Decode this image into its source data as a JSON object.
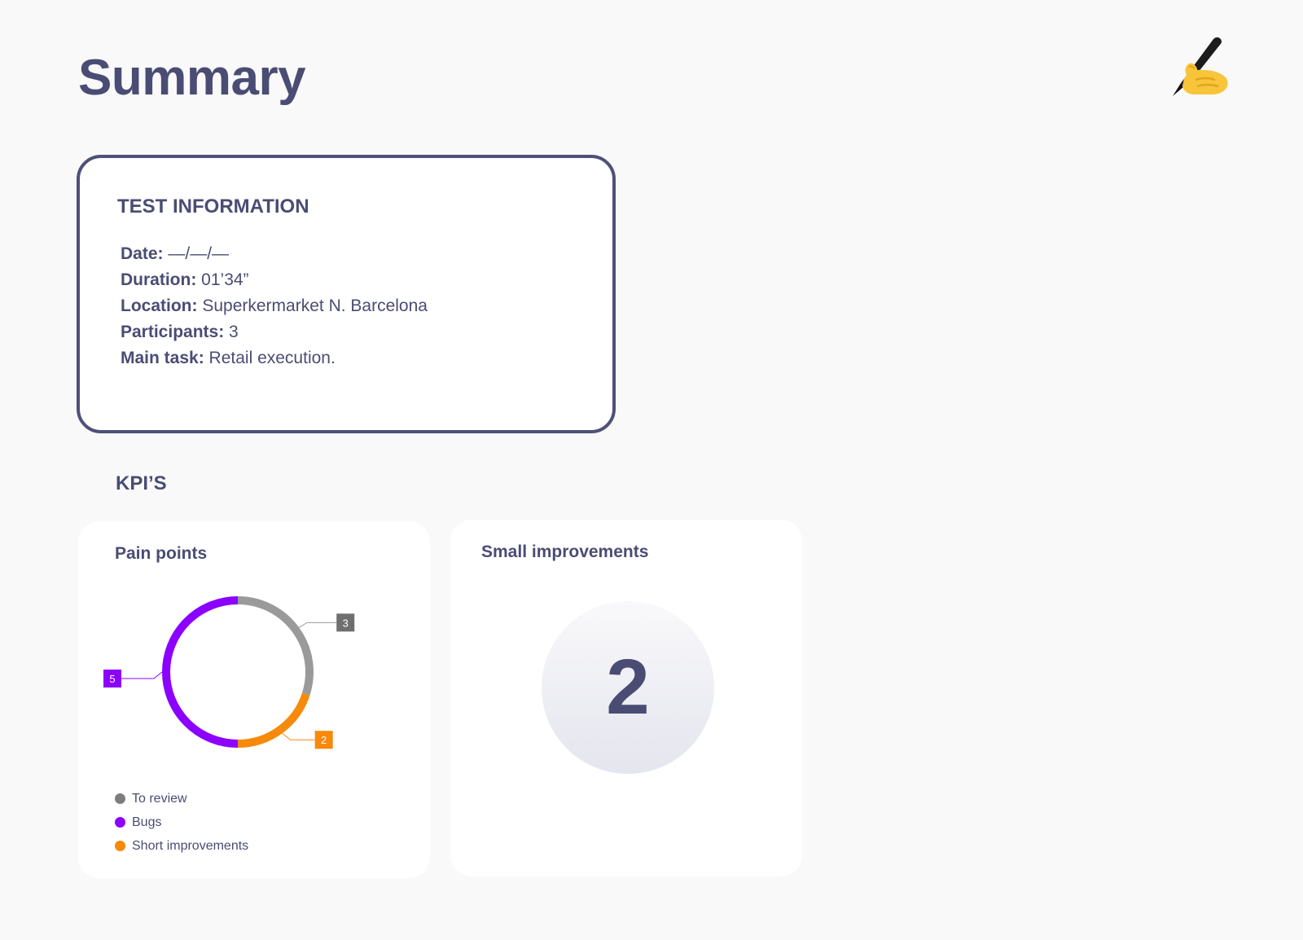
{
  "header": {
    "title": "Summary",
    "icon": "writing-hand-icon"
  },
  "test_information": {
    "title": "TEST INFORMATION",
    "rows": [
      {
        "label": "Date:",
        "value": "—/—/—"
      },
      {
        "label": "Duration:",
        "value": "01’34”"
      },
      {
        "label": "Location:",
        "value": "Superkermarket N. Barcelona"
      },
      {
        "label": "Participants:",
        "value": "3"
      },
      {
        "label": "Main task:",
        "value": "Retail execution."
      }
    ]
  },
  "kpis": {
    "title": "KPI’S",
    "pain_points": {
      "title": "Pain points",
      "legend": [
        {
          "label": "To review",
          "color": "#7d7d7d"
        },
        {
          "label": "Bugs",
          "color": "#8b00ff"
        },
        {
          "label": "Short improvements",
          "color": "#f7890b"
        }
      ]
    },
    "small_improvements": {
      "title": "Small improvements",
      "value": "2"
    }
  },
  "chart_data": {
    "type": "pie",
    "variant": "donut",
    "categories": [
      "To review",
      "Short improvements",
      "Bugs"
    ],
    "values": [
      3,
      2,
      5
    ],
    "colors": [
      "#9a9a9a",
      "#f7890b",
      "#8b00ff"
    ],
    "label_colors": [
      "#6f6f6f",
      "#f7890b",
      "#8b00ff"
    ],
    "start_angle": "top, clockwise",
    "legend": "bottom-left"
  }
}
